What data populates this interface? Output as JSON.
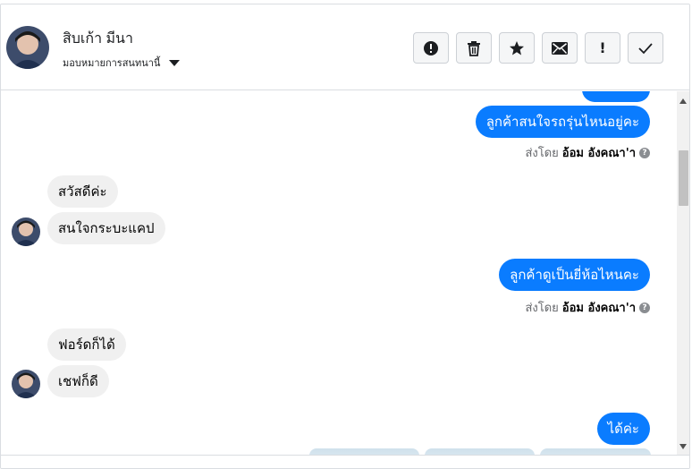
{
  "header": {
    "contact_name": "สิบเก้า มีนา",
    "assign_label": "มอบหมายการสนทนานี้",
    "actions": [
      {
        "icon": "alert-circle-icon",
        "label": "!"
      },
      {
        "icon": "trash-icon",
        "label": ""
      },
      {
        "icon": "star-icon",
        "label": ""
      },
      {
        "icon": "mail-icon",
        "label": ""
      },
      {
        "icon": "exclamation-icon",
        "label": "!"
      },
      {
        "icon": "check-icon",
        "label": ""
      }
    ]
  },
  "messages": [
    {
      "side": "out",
      "text": "ลูกค้าสนใจรถรุ่นไหนอยู่คะ"
    },
    {
      "side": "meta",
      "sent_by_prefix": "ส่งโดย",
      "sender": "อ้อม อังคณา'า",
      "help": "?"
    },
    {
      "side": "in",
      "text": "สวัสดีค่ะ"
    },
    {
      "side": "in",
      "text": "สนใจกระบะแคป"
    },
    {
      "side": "out",
      "text": "ลูกค้าดูเป็นยี่ห้อไหนคะ"
    },
    {
      "side": "meta",
      "sent_by_prefix": "ส่งโดย",
      "sender": "อ้อม อังคณา'า",
      "help": "?"
    },
    {
      "side": "in",
      "text": "ฟอร์ดก็ได้"
    },
    {
      "side": "in",
      "text": "เชฟก็ดี"
    },
    {
      "side": "out",
      "text": "ได้ค่ะ"
    }
  ],
  "colors": {
    "outgoing_bubble": "#0a7cff",
    "incoming_bubble": "#f0f0f0",
    "border": "#dadde1"
  }
}
